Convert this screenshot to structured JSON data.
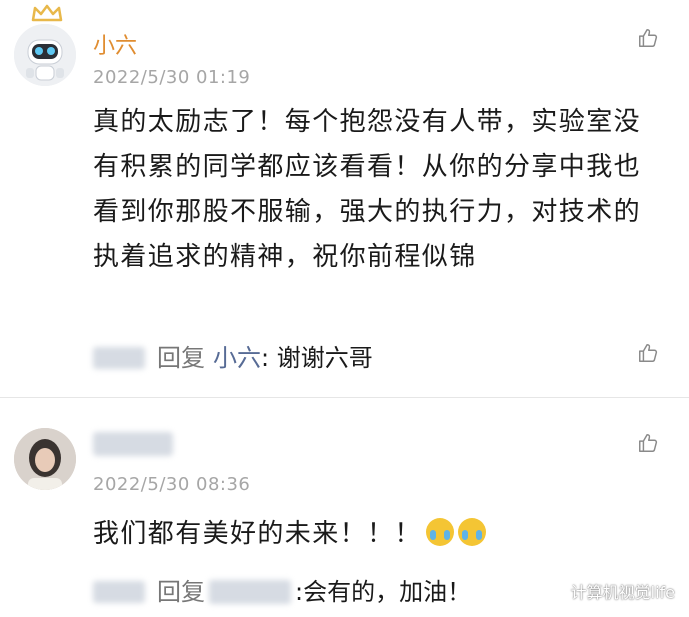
{
  "comments": [
    {
      "name": "小六",
      "time": "2022/5/30 01:19",
      "text": "真的太励志了！每个抱怨没有人带，实验室没有积累的同学都应该看看！从你的分享中我也看到你那股不服输，强大的执行力，对技术的执着追求的精神，祝你前程似锦",
      "reply": {
        "label": "回复",
        "replier": "小六",
        "separator": ":",
        "text": "谢谢六哥"
      }
    },
    {
      "time": "2022/5/30 08:36",
      "text": "我们都有美好的未来！！！",
      "reply": {
        "label": "回复",
        "separator": ":",
        "text": "会有的，加油！"
      }
    }
  ],
  "watermark": "计算机视觉life",
  "icons": {
    "like": "thumbs-up-icon",
    "crown": "crown-icon",
    "watermark": "wechat-channel-icon"
  },
  "colors": {
    "name": "#e08d31",
    "replier": "#576b95",
    "time": "#a6a6a6"
  }
}
